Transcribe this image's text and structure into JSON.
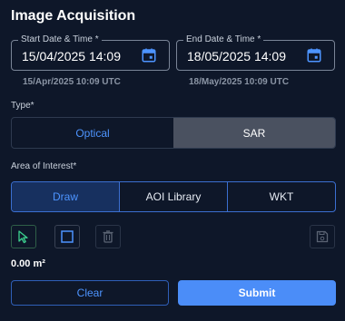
{
  "title": "Image Acquisition",
  "start_date": {
    "label": "Start Date & Time *",
    "value": "15/04/2025 14:09",
    "utc": "15/Apr/2025 10:09 UTC"
  },
  "end_date": {
    "label": "End Date & Time *",
    "value": "18/05/2025 14:09",
    "utc": "18/May/2025 10:09 UTC"
  },
  "type": {
    "label": "Type*",
    "options": [
      "Optical",
      "SAR"
    ],
    "selected": "SAR"
  },
  "aoi": {
    "label": "Area of Interest*",
    "options": [
      "Draw",
      "AOI Library",
      "WKT"
    ],
    "selected": "Draw"
  },
  "tools": {
    "icons": [
      "pointer-icon",
      "square-icon",
      "trash-icon",
      "save-icon"
    ]
  },
  "area_value": "0.00 m²",
  "actions": {
    "clear": "Clear",
    "submit": "Submit"
  },
  "colors": {
    "background": "#0e1729",
    "accent": "#4b8df8",
    "selected_segment": "#4a5160"
  }
}
